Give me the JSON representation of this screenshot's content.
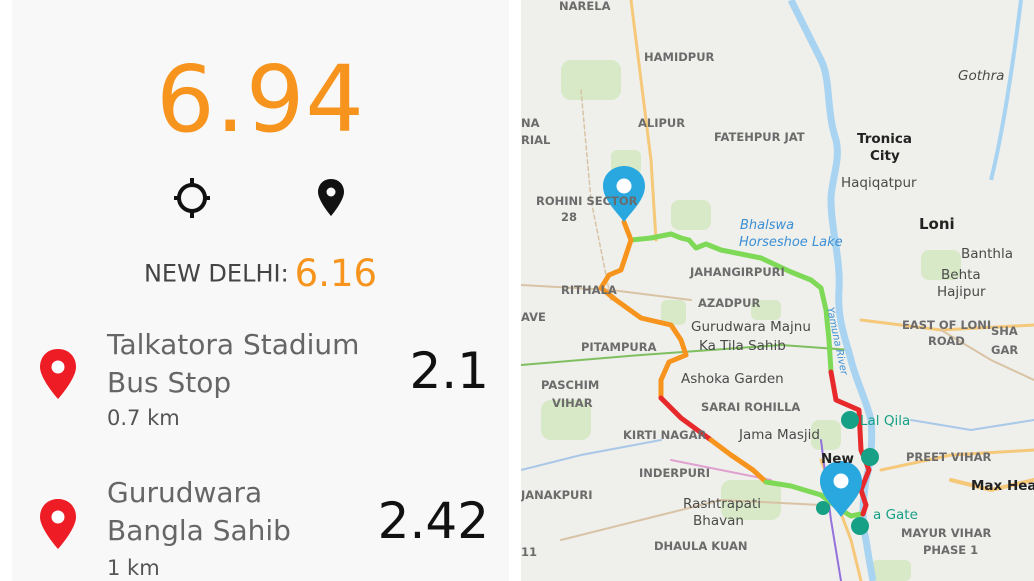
{
  "left": {
    "aqi": "6.94",
    "city_label": "NEW DELHI:",
    "city_value": "6.16",
    "stations": [
      {
        "name_line1": "Talkatora Stadium",
        "name_line2": "Bus Stop",
        "distance": "0.7 km",
        "value": "2.1"
      },
      {
        "name_line1": "Gurudwara",
        "name_line2": "Bangla Sahib",
        "distance": "1 km",
        "value": "2.42"
      }
    ],
    "colors": {
      "accent": "#f7941d",
      "pin": "#ee1c25"
    }
  },
  "map": {
    "labels": {
      "narela": "NARELA",
      "hamidpur": "HAMIDPUR",
      "gothra": "Gothra",
      "alipur": "ALIPUR",
      "fatehpur_jat": "FATEHPUR JAT",
      "tronica1": "Tronica",
      "tronica2": "City",
      "haqiqatpur": "Haqiqatpur",
      "na": "NA",
      "rial": "RIAL",
      "rohini1": "ROHINI SECTOR",
      "rohini2": "28",
      "bhalswa1": "Bhalswa",
      "bhalswa2": "Horseshoe Lake",
      "loni": "Loni",
      "banthla": "Banthla",
      "behta1": "Behta",
      "behta2": "Hajipur",
      "jahangirpuri": "JAHANGIRPURI",
      "rithala": "RITHALA",
      "azadpur": "AZADPUR",
      "ave": "AVE",
      "east_loni1": "EAST OF LONI",
      "east_loni2": "ROAD",
      "sha": "SHA",
      "gar": "GAR",
      "majnu1": "Gurudwara Majnu",
      "majnu2": "Ka Tila Sahib",
      "pitampura": "PITAMPURA",
      "paschim1": "PASCHIM",
      "paschim2": "VIHAR",
      "ashoka": "Ashoka Garden",
      "sarai": "SARAI ROHILLA",
      "lal_qila": "Lal Qila",
      "kirti": "KIRTI NAGAR",
      "jama": "Jama Masjid",
      "preet": "PREET VIHAR",
      "inderpuri": "INDERPURI",
      "new": "New",
      "max": "Max Hea",
      "janakpuri": "JANAKPURI",
      "rashtrapati1": "Rashtrapati",
      "rashtrapati2": "Bhavan",
      "gate": "a Gate",
      "mayur1": "MAYUR VIHAR",
      "mayur2": "PHASE 1",
      "dhaula": "DHAULA KUAN",
      "eleven": "11",
      "yamuna": "Yamuna River"
    }
  }
}
